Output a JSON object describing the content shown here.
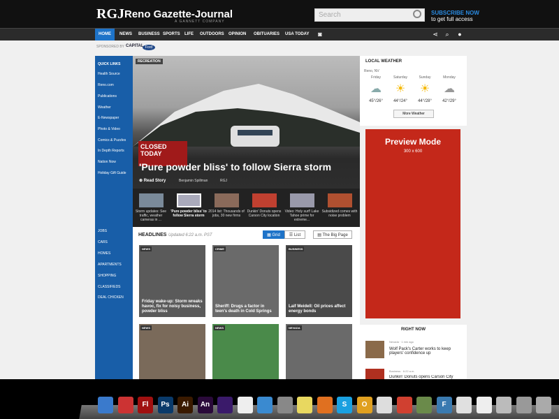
{
  "header": {
    "logo": "RGJ",
    "brand": "Reno Gazette-Journal",
    "brand_sub": "A GANNETT COMPANY",
    "search_placeholder": "Search",
    "subscribe_line1": "SUBSCRIBE NOW",
    "subscribe_line2": "to get full access"
  },
  "nav": {
    "items": [
      "HOME",
      "NEWS",
      "BUSINESS",
      "SPORTS",
      "LIFE",
      "OUTDOORS",
      "OPINION",
      "OBITUARIES",
      "USA TODAY"
    ],
    "icons": [
      "camera-icon",
      "share-icon",
      "search-icon",
      "user-icon"
    ]
  },
  "sponsor": {
    "label": "SPONSORED BY",
    "name": "CAPITAL",
    "badge": "Ford"
  },
  "sidebar": {
    "title": "QUICK LINKS",
    "links": [
      "Health Source",
      "Reno.com",
      "Publications",
      "Weather",
      "E-Newspaper",
      "Photo & Video",
      "Comics & Puzzles",
      "In Depth Reports",
      "Nation Now",
      "Holiday Gift Guide"
    ],
    "links2": [
      "JOBS",
      "CARS",
      "HOMES",
      "APARTMENTS",
      "SHOPPING",
      "CLASSIFIEDS",
      "DEAL CHICKEN"
    ]
  },
  "hero": {
    "tag": "RECREATION",
    "title": "'Pure powder bliss' to follow Sierra storm",
    "read_story": "Read Story",
    "byline": "Benjamin Spillman",
    "source": "RGJ"
  },
  "thumbs": [
    {
      "caption": "Storm updates: See traffic, weather cameras in ...",
      "color": "#7a8a9a"
    },
    {
      "caption": "'Pure powder bliss' to follow Sierra storm",
      "color": "#aab"
    },
    {
      "caption": "2014 list: Thousands of jobs, 30 new firms",
      "color": "#8a6a5a"
    },
    {
      "caption": "Dunkin' Donuts opens Carson City location",
      "color": "#c04030"
    },
    {
      "caption": "Video: Holy surf! Lake Tahoe prime for extreme...",
      "color": "#99a"
    },
    {
      "caption": "Subsidized comes with noise problem",
      "color": "#b05030"
    }
  ],
  "headlines": {
    "title": "HEADLINES",
    "updated": "Updated 6:22 a.m. PST",
    "grid": "Grid",
    "list": "List",
    "bigpage": "The Big Page"
  },
  "cards": [
    {
      "tag": "NEWS",
      "caption": "Friday wake-up: Storm wreaks havoc, fix for noisy business, powder bliss",
      "color": "#5a5a5a"
    },
    {
      "tag": "CRIME",
      "caption": "Sheriff: Drugs a factor in teen's death in Cold Springs",
      "color": "#6a6a6a"
    },
    {
      "tag": "BUSINESS",
      "caption": "Laif Meidell: Oil prices affect energy bonds",
      "color": "#4a4a4a"
    },
    {
      "tag": "NEWS",
      "caption": "",
      "color": "#7a6a5a"
    },
    {
      "tag": "NEWS",
      "caption": "",
      "color": "#4a8a4a"
    },
    {
      "tag": "NEVADA",
      "caption": "",
      "color": "#6a6a6a"
    }
  ],
  "weather": {
    "title": "LOCAL WEATHER",
    "location": "Reno, NV",
    "days": [
      {
        "day": "Friday",
        "temp": "45°/26°",
        "icon": "rain-cloud-icon"
      },
      {
        "day": "Saturday",
        "temp": "44°/24°",
        "icon": "partly-sunny-icon"
      },
      {
        "day": "Sunday",
        "temp": "44°/28°",
        "icon": "partly-sunny-icon"
      },
      {
        "day": "Monday",
        "temp": "42°/29°",
        "icon": "cloud-icon"
      }
    ],
    "more": "More Weather"
  },
  "preview": {
    "title": "Preview Mode",
    "size": "300 x 600"
  },
  "right_now": {
    "title": "RIGHT NOW",
    "items": [
      {
        "source": "Nevada · 1 min ago",
        "text": "Wolf Pack's Carter works to keep players' confidence up"
      },
      {
        "source": "Business · 6:22 a.m.",
        "text": "Dunkin' Donuts opens Carson City"
      }
    ]
  },
  "dock": {
    "icons": [
      {
        "name": "finder-icon",
        "label": "",
        "color": "#3a7acc"
      },
      {
        "name": "adtracker-icon",
        "label": "",
        "color": "#c33"
      },
      {
        "name": "flash-icon",
        "label": "Fl",
        "color": "#a01010"
      },
      {
        "name": "photoshop-icon",
        "label": "Ps",
        "color": "#0a3a6a"
      },
      {
        "name": "illustrator-icon",
        "label": "Ai",
        "color": "#3a1a00"
      },
      {
        "name": "animate-icon",
        "label": "An",
        "color": "#2a0a3a"
      },
      {
        "name": "premiere-icon",
        "label": "",
        "color": "#3a1a6a"
      },
      {
        "name": "acrobat-icon",
        "label": "",
        "color": "#eee"
      },
      {
        "name": "itunes-icon",
        "label": "",
        "color": "#3a8ad0"
      },
      {
        "name": "preview-app-icon",
        "label": "",
        "color": "#888"
      },
      {
        "name": "stickies-icon",
        "label": "",
        "color": "#e8d860"
      },
      {
        "name": "firefox-icon",
        "label": "",
        "color": "#e07020"
      },
      {
        "name": "skype-icon",
        "label": "S",
        "color": "#1aa0e0"
      },
      {
        "name": "outlook-icon",
        "label": "O",
        "color": "#e0a020"
      },
      {
        "name": "launchpad-icon",
        "label": "",
        "color": "#ddd"
      },
      {
        "name": "chrome-icon",
        "label": "",
        "color": "#d04030"
      },
      {
        "name": "chess-icon",
        "label": "",
        "color": "#6a8a4a"
      },
      {
        "name": "fontcase-icon",
        "label": "F",
        "color": "#3a7ab0"
      },
      {
        "name": "photos-icon",
        "label": "",
        "color": "#e0e0e0"
      },
      {
        "name": "pdf-icon",
        "label": "",
        "color": "#eee"
      },
      {
        "name": "folder-icon",
        "label": "",
        "color": "#bbb"
      },
      {
        "name": "downloads-icon",
        "label": "",
        "color": "#999"
      },
      {
        "name": "trash-icon",
        "label": "",
        "color": "#aaa"
      }
    ]
  }
}
